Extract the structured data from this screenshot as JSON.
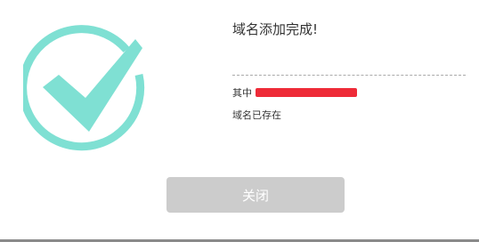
{
  "dialog": {
    "title": "域名添加完成!",
    "detail_label": "其中",
    "status_text": "域名已存在",
    "close_label": "关闭"
  },
  "colors": {
    "check_color": "#7fe0d3",
    "redaction_color": "#ee2b38",
    "button_bg": "#cccccc"
  },
  "icons": {
    "success": "check-circle-icon"
  }
}
